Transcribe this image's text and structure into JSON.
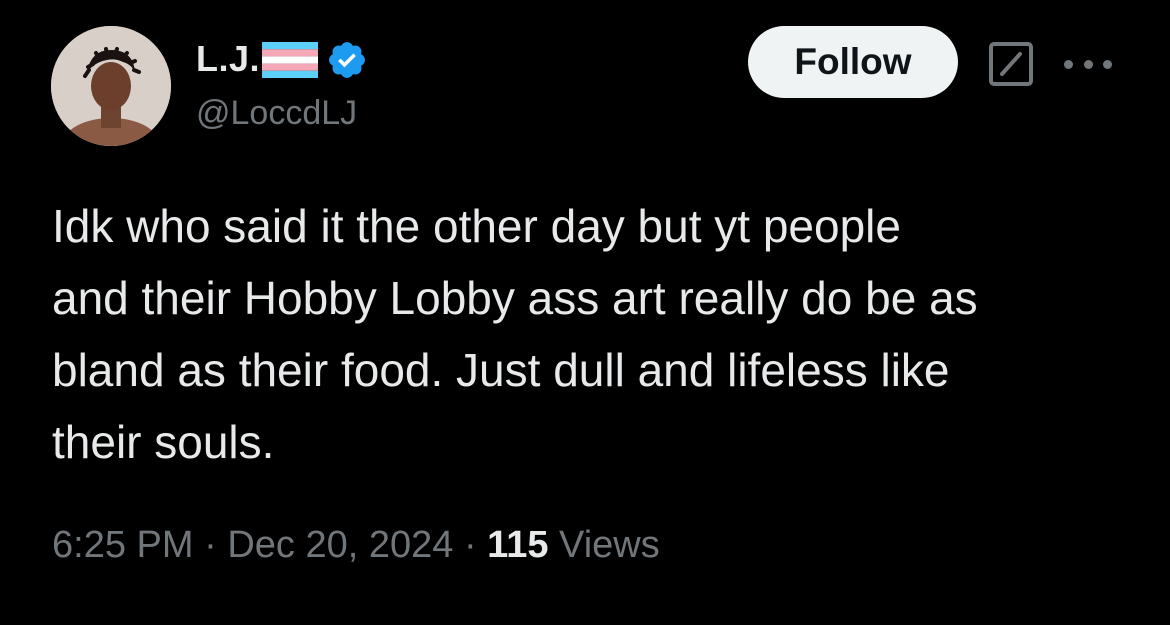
{
  "author": {
    "display_name": "L.J.",
    "handle": "@LoccdLJ",
    "flag_icon": "transgender-flag-icon",
    "verified_icon": "verified-badge-icon",
    "verified_color": "#1d9bf0",
    "flag_colors": [
      "#5bcefa",
      "#f5a9b8",
      "#ffffff",
      "#f5a9b8",
      "#5bcefa"
    ]
  },
  "actions": {
    "follow_label": "Follow",
    "grok_icon": "grok-icon",
    "more_icon": "more-options-icon"
  },
  "tweet": {
    "text_lines": [
      "Idk who said it the other day but yt people",
      "and their Hobby Lobby ass art really do be as",
      "bland as their food. Just dull and lifeless like",
      "their souls."
    ]
  },
  "meta": {
    "time": "6:25 PM",
    "separator": "·",
    "date": "Dec 20, 2024",
    "views_count": "115",
    "views_label": "Views"
  },
  "colors": {
    "background": "#000000",
    "primary_text": "#e7e9ea",
    "secondary_text": "#71767b",
    "follow_bg": "#eff3f4"
  }
}
